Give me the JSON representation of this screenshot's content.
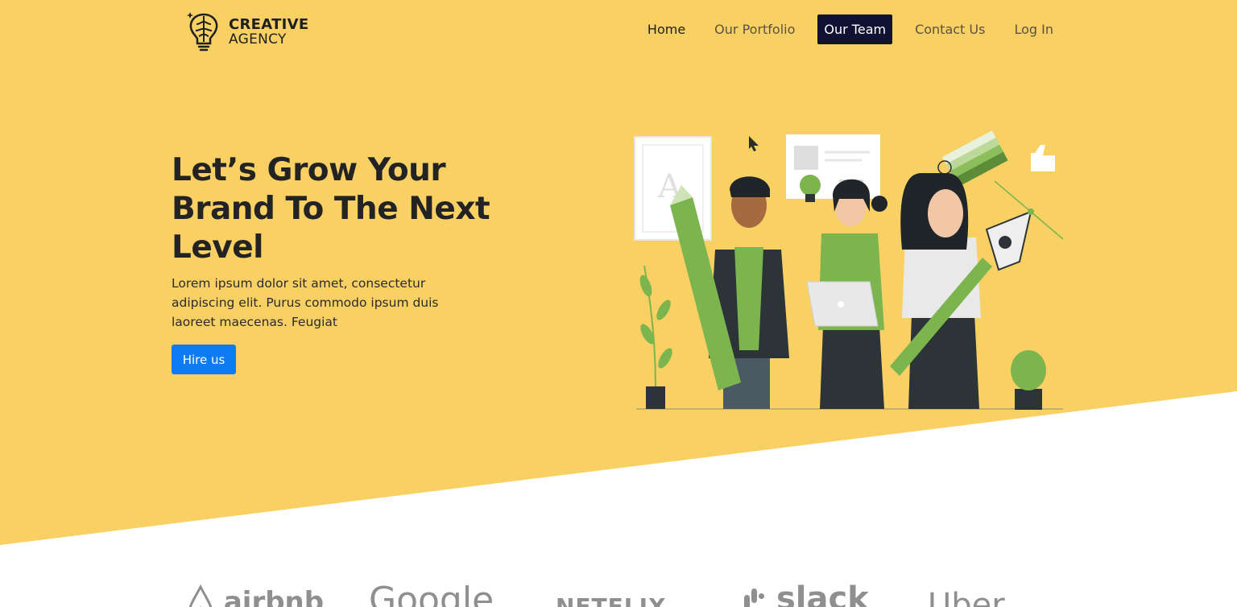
{
  "brand": {
    "name_line1": "CREATIVE",
    "name_line2": "AGENCY",
    "logo_icon": "brain-bulb-icon"
  },
  "nav": {
    "items": [
      {
        "label": "Home",
        "active": false
      },
      {
        "label": "Our Portfolio",
        "active": false
      },
      {
        "label": "Our Team",
        "active": true
      },
      {
        "label": "Contact Us",
        "active": false
      },
      {
        "label": "Log In",
        "active": false
      }
    ]
  },
  "hero": {
    "title": "Let’s Grow Your Brand To The Next Level",
    "description": "Lorem ipsum dolor sit amet, consectetur adipiscing elit. Purus commodo ipsum duis laoreet maecenas. Feugiat",
    "cta_label": "Hire us",
    "illustration": "team-illustration"
  },
  "partners": [
    {
      "name": "airbnb"
    },
    {
      "name": "Google"
    },
    {
      "name": "NETFLIX"
    },
    {
      "name": "slack"
    },
    {
      "name": "Uber"
    }
  ],
  "colors": {
    "hero_background": "#f9d064",
    "accent_green": "#7cb44e",
    "button_blue": "#0d7cf2",
    "active_nav": "#111133",
    "dark_text": "#232323"
  }
}
